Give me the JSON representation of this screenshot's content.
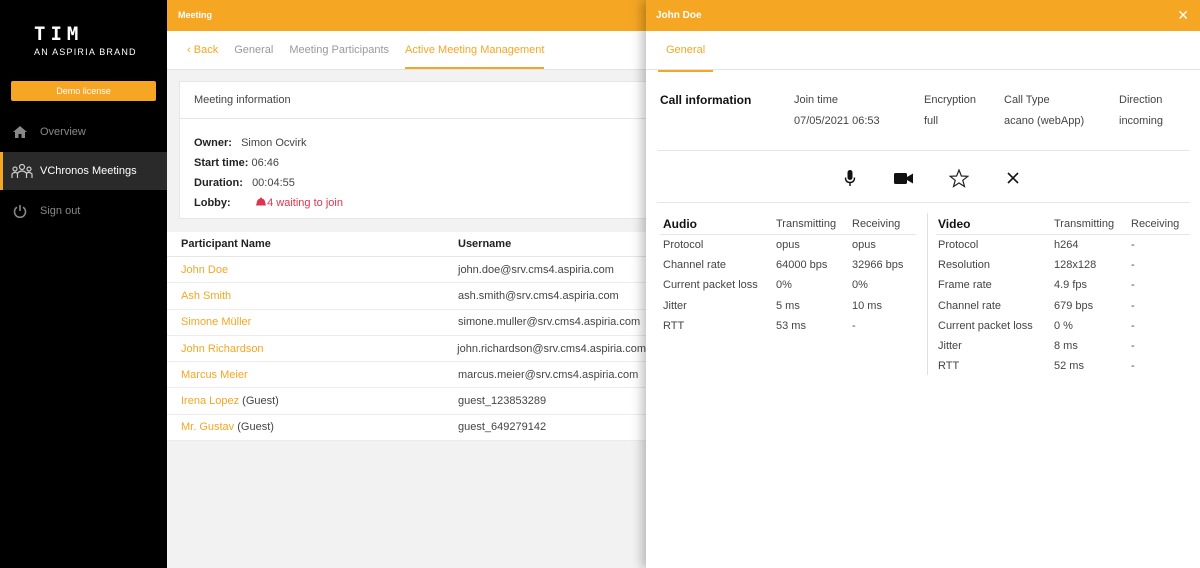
{
  "sidebar": {
    "brand": "TIM",
    "brand_sub": "AN ASPIRIA BRAND",
    "license": "Demo license",
    "items": [
      {
        "label": "Overview",
        "icon": "home-icon"
      },
      {
        "label": "VChronos Meetings",
        "icon": "people-icon"
      },
      {
        "label": "Sign out",
        "icon": "power-icon"
      }
    ]
  },
  "main": {
    "title": "Meeting",
    "tabs": [
      "Back",
      "General",
      "Meeting Participants",
      "Active Meeting Management"
    ],
    "meeting_info": {
      "heading": "Meeting information",
      "owner_label": "Owner:",
      "owner": "Simon Ocvirk",
      "start_label": "Start time:",
      "start": "06:46",
      "duration_label": "Duration:",
      "duration": "00:04:55",
      "lobby_label": "Lobby:",
      "lobby": "4 waiting to join"
    },
    "participants": {
      "headers": [
        "Participant Name",
        "Username"
      ],
      "rows": [
        {
          "name": "John Doe",
          "suffix": "",
          "username": "john.doe@srv.cms4.aspiria.com"
        },
        {
          "name": "Ash Smith",
          "suffix": "",
          "username": "ash.smith@srv.cms4.aspiria.com"
        },
        {
          "name": "Simone Müller",
          "suffix": "",
          "username": "simone.muller@srv.cms4.aspiria.com"
        },
        {
          "name": "John Richardson",
          "suffix": "",
          "username": "john.richardson@srv.cms4.aspiria.com"
        },
        {
          "name": "Marcus Meier",
          "suffix": "",
          "username": "marcus.meier@srv.cms4.aspiria.com"
        },
        {
          "name": "Irena Lopez",
          "suffix": "(Guest)",
          "username": "guest_123853289"
        },
        {
          "name": "Mr. Gustav",
          "suffix": "(Guest)",
          "username": "guest_649279142"
        }
      ]
    }
  },
  "panel": {
    "title": "John Doe",
    "tab": "General",
    "call_info": {
      "title": "Call information",
      "labels": [
        "Join time",
        "Encryption",
        "Call Type",
        "Direction"
      ],
      "values": [
        "07/05/2021 06:53",
        "full",
        "acano (webApp)",
        "incoming"
      ]
    },
    "controls": [
      "microphone-icon",
      "camera-icon",
      "star-icon",
      "close-icon"
    ],
    "audio": {
      "title": "Audio",
      "headers": [
        "Transmitting",
        "Receiving"
      ],
      "rows": [
        {
          "label": "Protocol",
          "tx": "opus",
          "rx": "opus"
        },
        {
          "label": "Channel rate",
          "tx": "64000 bps",
          "rx": "32966 bps"
        },
        {
          "label": "Current packet loss",
          "tx": "0%",
          "rx": "0%"
        },
        {
          "label": "Jitter",
          "tx": "5 ms",
          "rx": "10 ms"
        },
        {
          "label": "RTT",
          "tx": "53 ms",
          "rx": "-"
        }
      ]
    },
    "video": {
      "title": "Video",
      "headers": [
        "Transmitting",
        "Receiving"
      ],
      "rows": [
        {
          "label": "Protocol",
          "tx": "h264",
          "rx": "-"
        },
        {
          "label": "Resolution",
          "tx": "128x128",
          "rx": "-"
        },
        {
          "label": "Frame rate",
          "tx": "4.9 fps",
          "rx": "-"
        },
        {
          "label": "Channel rate",
          "tx": "679 bps",
          "rx": "-"
        },
        {
          "label": "Current packet loss",
          "tx": "0 %",
          "rx": "-"
        },
        {
          "label": "Jitter",
          "tx": "8 ms",
          "rx": "-"
        },
        {
          "label": "RTT",
          "tx": "52 ms",
          "rx": "-"
        }
      ]
    }
  }
}
